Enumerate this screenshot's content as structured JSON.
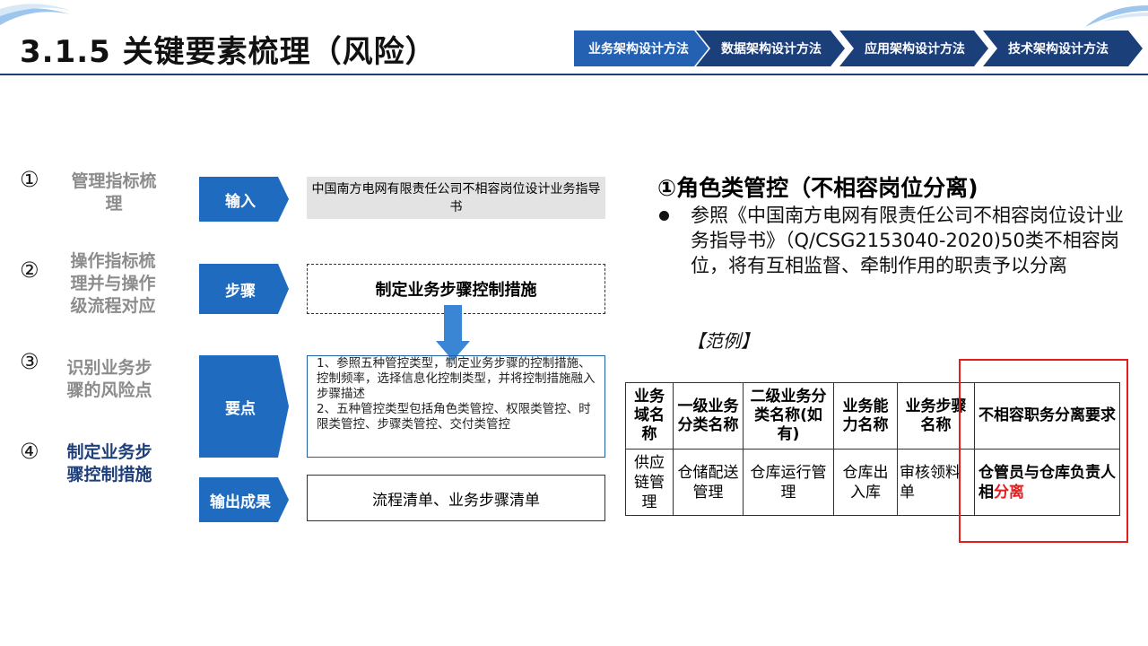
{
  "header": {
    "title": "3.1.5 关键要素梳理（风险）",
    "nav_steps": [
      {
        "label": "业务架构设计方法",
        "active": true
      },
      {
        "label": "数据架构设计方法",
        "active": false
      },
      {
        "label": "应用架构设计方法",
        "active": false
      },
      {
        "label": "技术架构设计方法",
        "active": false
      }
    ]
  },
  "steps": [
    {
      "num": "①",
      "label": "管理指标梳理",
      "active": false
    },
    {
      "num": "②",
      "label": "操作指标梳理并与操作级流程对应",
      "active": false
    },
    {
      "num": "③",
      "label": "识别业务步骤的风险点",
      "active": false
    },
    {
      "num": "④",
      "label": "制定业务步骤控制措施",
      "active": true
    }
  ],
  "flow": {
    "input_tag": "输入",
    "input_text": "中国南方电网有限责任公司不相容岗位设计业务指导书",
    "step_tag": "步骤",
    "step_text": "制定业务步骤控制措施",
    "points_tag": "要点",
    "points_line1": "1、参照五种管控类型，制定业务步骤的控制措施、控制频率，选择信息化控制类型，并将控制措施融入步骤描述",
    "points_line2": "2、五种管控类型包括角色类管控、权限类管控、时限类管控、步骤类管控、交付类管控",
    "output_tag": "输出成果",
    "output_text": "流程清单、业务步骤清单"
  },
  "right": {
    "section_title": "①角色类管控（不相容岗位分离)",
    "bullet": "参照《中国南方电网有限责任公司不相容岗位设计业务指导书》（Q/CSG2153040-2020)50类不相容岗位，将有互相监督、牵制作用的职责予以分离",
    "example_label": "【范例】",
    "table": {
      "headers": [
        "业务域名称",
        "一级业务分类名称",
        "二级业务分类名称(如有)",
        "业务能力名称",
        "业务步骤名称",
        "不相容职务分离要求"
      ],
      "row": [
        "供应链管理",
        "仓储配送管理",
        "仓库运行管理",
        "仓库出入库",
        "审核领料单"
      ],
      "req_prefix": "仓管员与仓库负责人相",
      "req_highlight": "分离"
    }
  },
  "colors": {
    "accent_blue": "#1f5fa8",
    "nav_active": "#2461b3",
    "nav_inactive": "#1b3f78",
    "highlight_red": "#e41d1d",
    "step_inactive_gray": "#8c8c8c",
    "step_active_navy": "#1f3f7a"
  }
}
